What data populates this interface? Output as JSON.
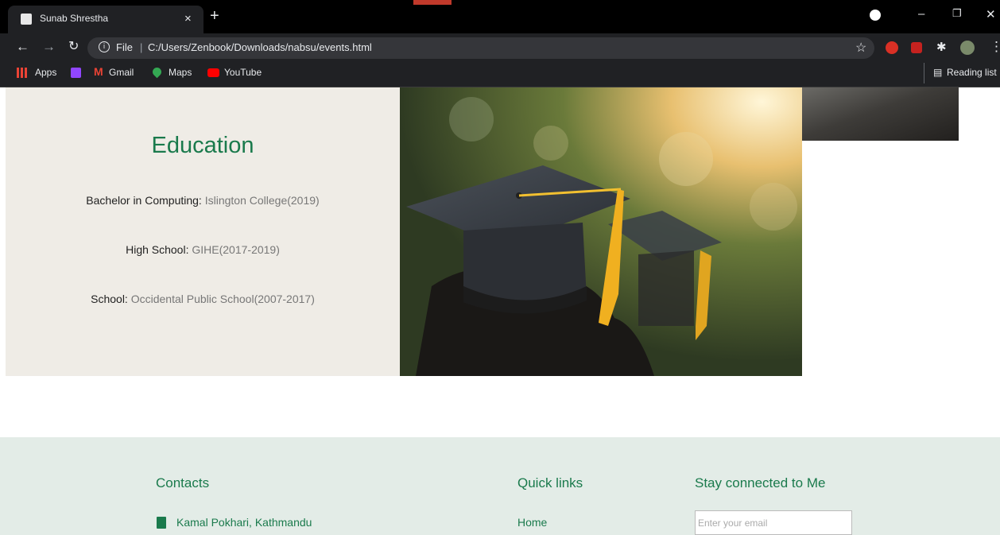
{
  "browser": {
    "tab_title": "Sunab Shrestha",
    "tab_close": "×",
    "new_tab": "+",
    "scheme": "File",
    "url": "C:/Users/Zenbook/Downloads/nabsu/events.html",
    "bookmarks": [
      {
        "label": "Apps",
        "icon": "apps-grid-icon",
        "color": "#ea4335"
      },
      {
        "label": "",
        "icon": "twitch-icon",
        "color": "#9146ff"
      },
      {
        "label": "Gmail",
        "icon": "gmail-icon",
        "color": "#ea4335"
      },
      {
        "label": "Maps",
        "icon": "maps-pin-icon",
        "color": "#34a853"
      },
      {
        "label": "YouTube",
        "icon": "youtube-icon",
        "color": "#ff0000"
      }
    ],
    "reading_list": "Reading list"
  },
  "education": {
    "title": "Education",
    "entries": [
      {
        "label": "Bachelor in Computing:",
        "value": "Islington College(2019)"
      },
      {
        "label": "High School:",
        "value": "GIHE(2017-2019)"
      },
      {
        "label": "School:",
        "value": "Occidental Public School(2007-2017)"
      }
    ]
  },
  "footer": {
    "contacts_title": "Contacts",
    "address": "Kamal Pokhari, Kathmandu",
    "quick_links_title": "Quick links",
    "home_link": "Home",
    "stay_connected_title": "Stay connected to Me",
    "email_placeholder": "Enter your email"
  },
  "colors": {
    "accent": "#1a7a4c",
    "panel": "#efece6",
    "footer": "#e3ece7"
  }
}
